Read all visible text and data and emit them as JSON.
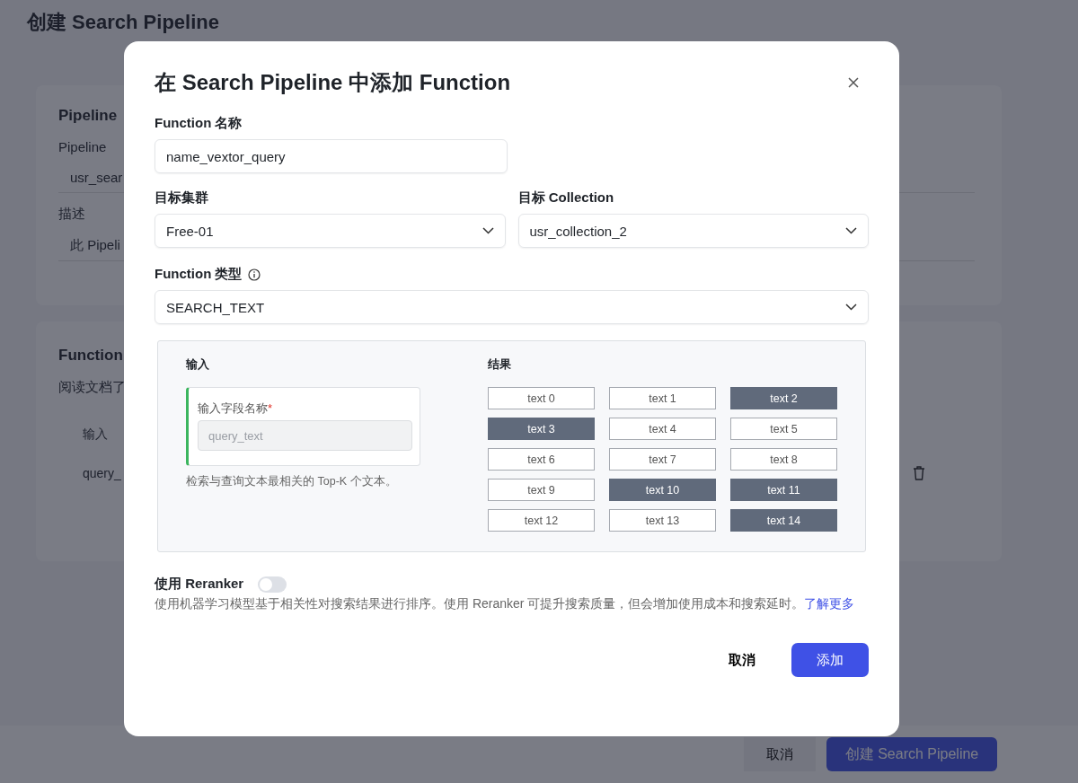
{
  "page": {
    "title": "创建 Search Pipeline",
    "pipeline_section": {
      "title": "Pipeline",
      "name_label": "Pipeline",
      "name_value": "usr_sear",
      "description_label": "描述",
      "description_value": "此 Pipeli"
    },
    "function_section": {
      "title": "Function",
      "description": "阅读文档了",
      "column": "输入",
      "cell": "query_"
    },
    "footer": {
      "cancel": "取消",
      "create": "创建 Search Pipeline"
    }
  },
  "dialog": {
    "title": "在 Search Pipeline 中添加 Function",
    "function_name": {
      "label": "Function 名称",
      "value": "name_vextor_query"
    },
    "target_cluster": {
      "label": "目标集群",
      "value": "Free-01"
    },
    "target_collection": {
      "label": "目标 Collection",
      "value": "usr_collection_2"
    },
    "function_type": {
      "label": "Function 类型",
      "value": "SEARCH_TEXT"
    },
    "input": {
      "title": "输入",
      "field_label": "输入字段名称",
      "required_mark": "*",
      "placeholder": "query_text",
      "hint": "检索与查询文本最相关的 Top-K 个文本。"
    },
    "results": {
      "title": "结果",
      "items": [
        {
          "label": "text 0",
          "selected": false
        },
        {
          "label": "text 1",
          "selected": false
        },
        {
          "label": "text 2",
          "selected": true
        },
        {
          "label": "text 3",
          "selected": true
        },
        {
          "label": "text 4",
          "selected": false
        },
        {
          "label": "text 5",
          "selected": false
        },
        {
          "label": "text 6",
          "selected": false
        },
        {
          "label": "text 7",
          "selected": false
        },
        {
          "label": "text 8",
          "selected": false
        },
        {
          "label": "text 9",
          "selected": false
        },
        {
          "label": "text 10",
          "selected": true
        },
        {
          "label": "text 11",
          "selected": true
        },
        {
          "label": "text 12",
          "selected": false
        },
        {
          "label": "text 13",
          "selected": false
        },
        {
          "label": "text 14",
          "selected": true
        }
      ]
    },
    "reranker": {
      "label": "使用 Reranker",
      "on": false,
      "description": "使用机器学习模型基于相关性对搜索结果进行排序。使用 Reranker 可提升搜索质量，但会增加使用成本和搜索延时。",
      "link": "了解更多"
    },
    "buttons": {
      "cancel": "取消",
      "add": "添加"
    }
  }
}
